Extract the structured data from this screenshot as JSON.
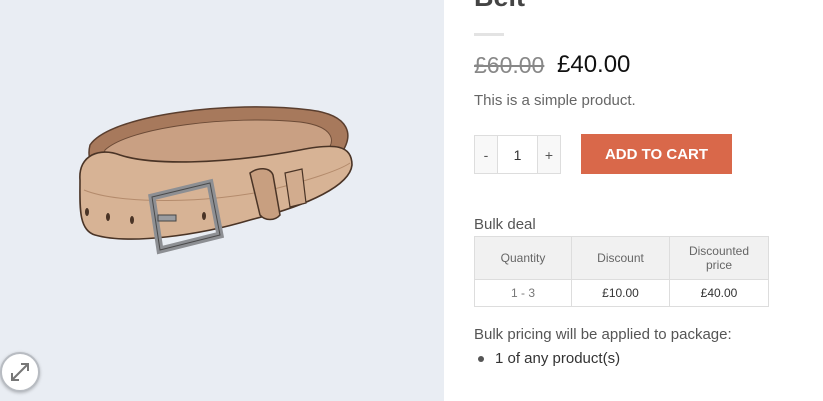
{
  "product": {
    "title": "Belt",
    "price_old": "£60.00",
    "price_new": "£40.00",
    "description": "This is a simple product."
  },
  "cart": {
    "minus_label": "-",
    "plus_label": "+",
    "quantity": "1",
    "add_label": "Add to cart"
  },
  "bulk": {
    "title": "Bulk deal",
    "headers": [
      "Quantity",
      "Discount",
      "Discounted price"
    ],
    "rows": [
      [
        "1 - 3",
        "£10.00",
        "£40.00"
      ]
    ]
  },
  "package": {
    "note": "Bulk pricing will be applied to package:",
    "items": [
      "1 of any product(s)"
    ]
  },
  "icons": {
    "zoom": "expand-arrows-icon"
  },
  "colors": {
    "add_button": "#d9684a",
    "gallery_bg": "#e9edf3"
  }
}
